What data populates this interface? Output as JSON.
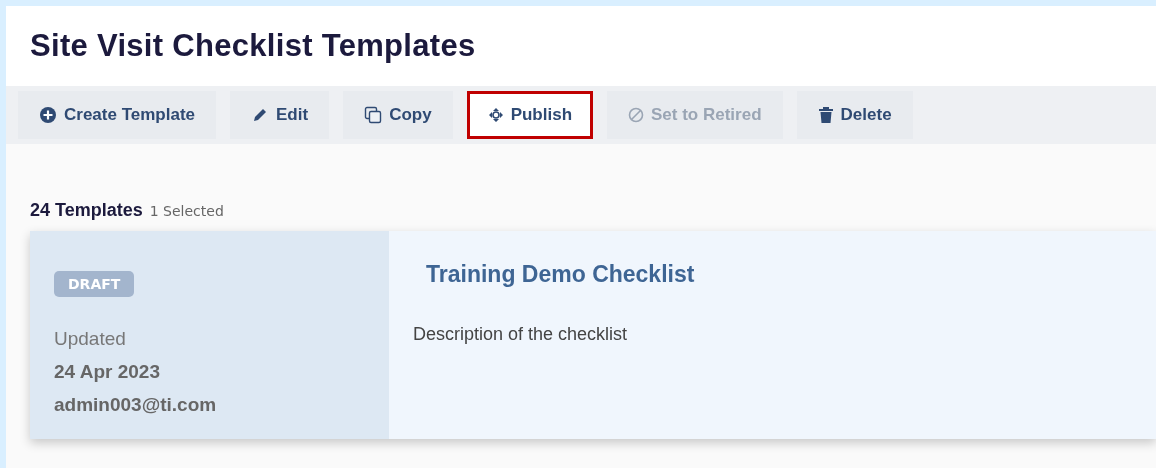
{
  "page": {
    "title": "Site Visit Checklist Templates"
  },
  "toolbar": [
    {
      "label": "Create Template",
      "disabled": false,
      "highlighted": false
    },
    {
      "label": "Edit",
      "disabled": false,
      "highlighted": false
    },
    {
      "label": "Copy",
      "disabled": false,
      "highlighted": false
    },
    {
      "label": "Publish",
      "disabled": false,
      "highlighted": true
    },
    {
      "label": "Set to Retired",
      "disabled": true,
      "highlighted": false
    },
    {
      "label": "Delete",
      "disabled": false,
      "highlighted": false
    }
  ],
  "list": {
    "count": "24 Templates",
    "selection": "1 Selected",
    "items": [
      {
        "status": "DRAFT",
        "updated_label": "Updated",
        "date": "24 Apr 2023",
        "user": "admin003@ti.com",
        "name": "Training Demo Checklist",
        "description": "Description of the checklist",
        "selected": true
      }
    ]
  }
}
